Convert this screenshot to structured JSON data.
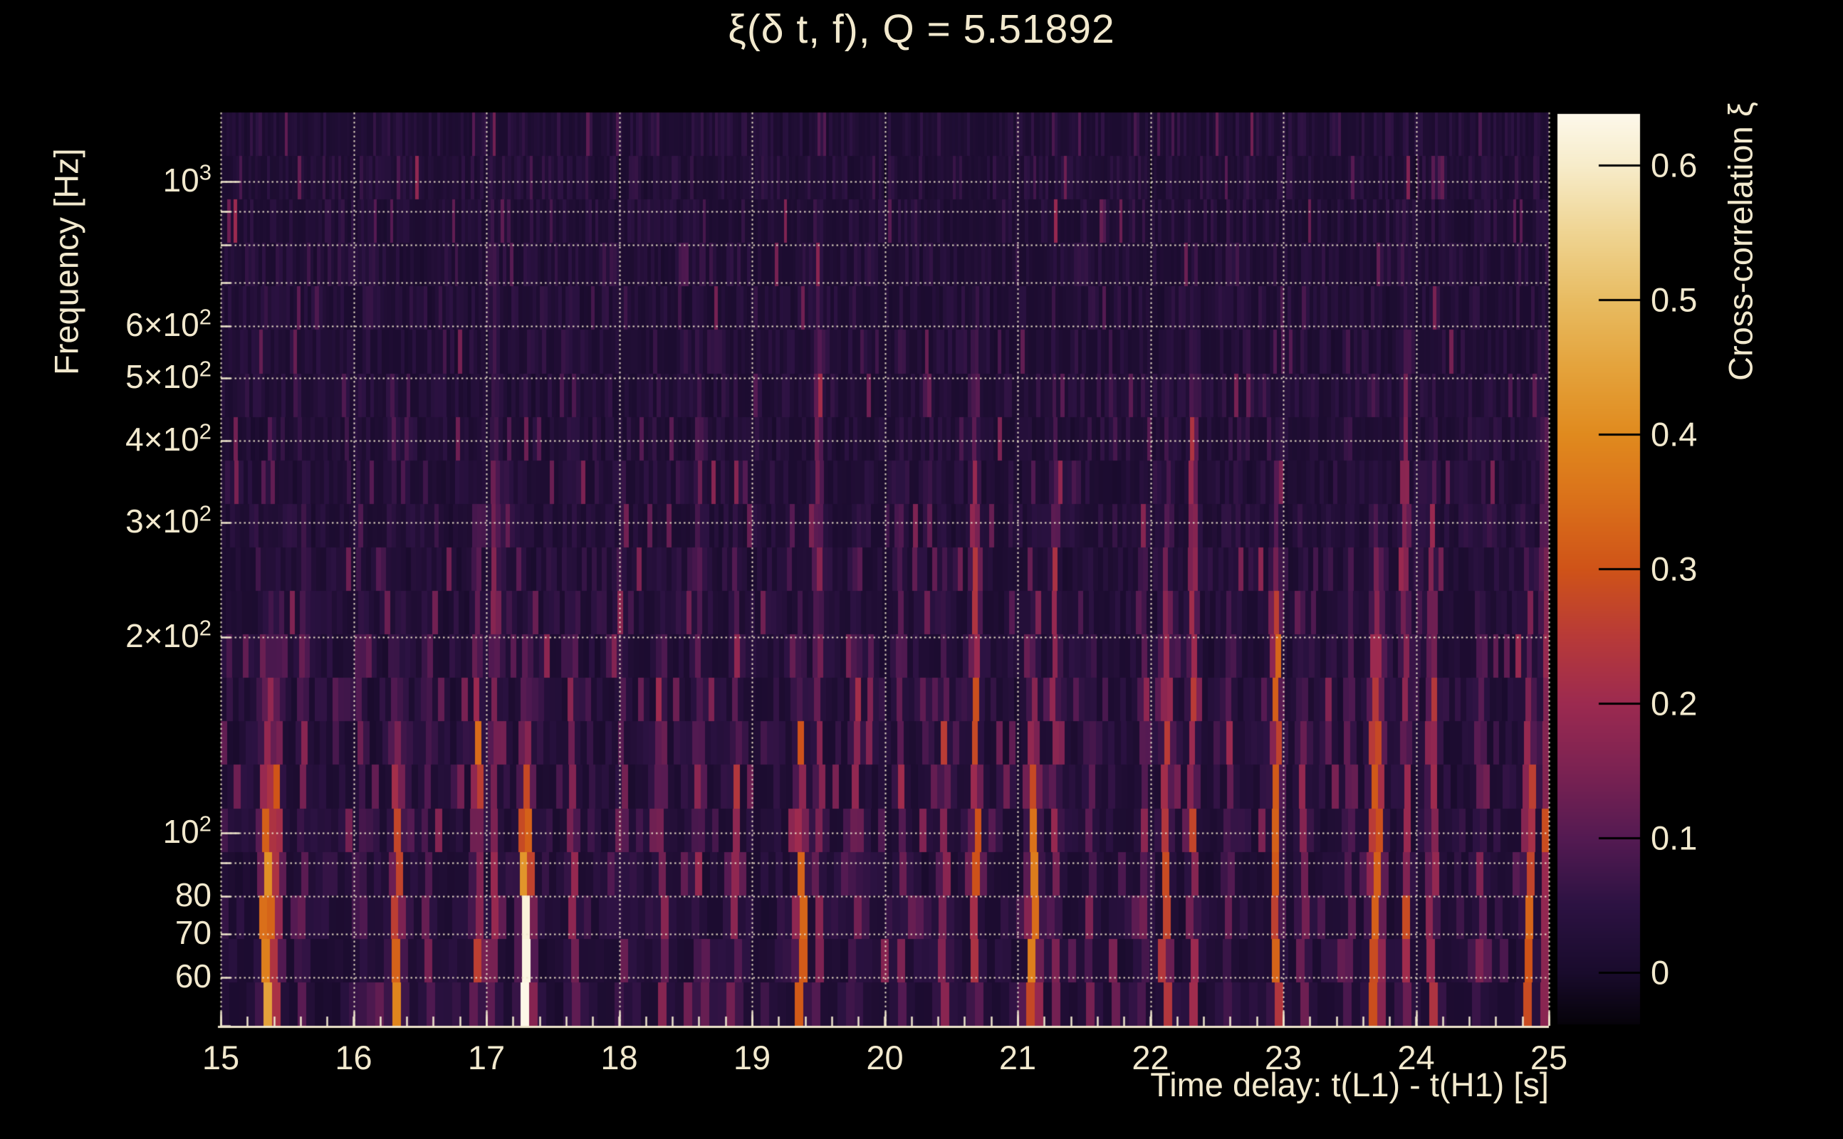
{
  "background": "#000000",
  "text_color": "#f2e9ce",
  "grid_color": "#efe6cc",
  "chart_data": {
    "type": "heatmap",
    "title": "ξ(δ t, f), Q = 5.51892",
    "q_value": "5.51892",
    "xlabel": "Time delay: t(L1) - t(H1) [s]",
    "ylabel": "Frequency [Hz]",
    "colorbar_label": "Cross-correlation ξ",
    "x_range": [
      15,
      25
    ],
    "x_ticks": [
      15,
      16,
      17,
      18,
      19,
      20,
      21,
      22,
      23,
      24,
      25
    ],
    "x_minor_step": 0.2,
    "y_scale": "log",
    "y_range_hz": [
      50.6,
      1277
    ],
    "y_ticks": [
      {
        "f": 1000,
        "m": "10",
        "e": "3"
      },
      {
        "f": 600,
        "m": "6×10",
        "e": "2"
      },
      {
        "f": 500,
        "m": "5×10",
        "e": "2"
      },
      {
        "f": 400,
        "m": "4×10",
        "e": "2"
      },
      {
        "f": 300,
        "m": "3×10",
        "e": "2"
      },
      {
        "f": 200,
        "m": "2×10",
        "e": "2"
      },
      {
        "f": 100,
        "m": "10",
        "e": "2"
      },
      {
        "f": 80,
        "m": "80"
      },
      {
        "f": 70,
        "m": "70"
      },
      {
        "f": 60,
        "m": "60"
      }
    ],
    "y_gridlines_hz": [
      60,
      70,
      80,
      90,
      100,
      200,
      300,
      400,
      500,
      600,
      700,
      800,
      900,
      1000
    ],
    "grid": "dotted",
    "color_range": [
      -0.038,
      0.638
    ],
    "colorbar_ticks": [
      {
        "v": 0.6,
        "label": "0.6"
      },
      {
        "v": 0.5,
        "label": "0.5"
      },
      {
        "v": 0.4,
        "label": "0.4"
      },
      {
        "v": 0.3,
        "label": "0.3"
      },
      {
        "v": 0.2,
        "label": "0.2"
      },
      {
        "v": 0.1,
        "label": "0.1"
      },
      {
        "v": 0.0,
        "label": "0"
      }
    ],
    "colormap": {
      "name": "inferno-like",
      "stops": [
        [
          -0.04,
          "#050208"
        ],
        [
          0.0,
          "#190b2c"
        ],
        [
          0.05,
          "#2c1242"
        ],
        [
          0.1,
          "#541a52"
        ],
        [
          0.15,
          "#7b2252"
        ],
        [
          0.2,
          "#9c2a50"
        ],
        [
          0.25,
          "#b83a38"
        ],
        [
          0.3,
          "#cf5318"
        ],
        [
          0.35,
          "#da701a"
        ],
        [
          0.4,
          "#e08a1e"
        ],
        [
          0.45,
          "#e4a33c"
        ],
        [
          0.5,
          "#e8bc62"
        ],
        [
          0.55,
          "#efd492"
        ],
        [
          0.6,
          "#f7ecca"
        ],
        [
          0.638,
          "#fdf8ea"
        ]
      ]
    },
    "rows": 21,
    "noise": {
      "seed": 20250419,
      "base": 0.008,
      "spread": 0.055,
      "midband_center_logf": 2.15,
      "midband_sigma": 0.3
    },
    "streaks": [
      {
        "t": 15.35,
        "xi": 0.4,
        "fmax_hz": 75,
        "w": 0.03
      },
      {
        "t": 15.43,
        "xi": 0.18,
        "fmax_hz": 95,
        "w": 0.025
      },
      {
        "t": 15.62,
        "xi": 0.1,
        "fmax_hz": 150,
        "w": 0.02
      },
      {
        "t": 16.05,
        "xi": 0.08,
        "fmax_hz": 120,
        "w": 0.02
      },
      {
        "t": 16.33,
        "xi": 0.34,
        "fmax_hz": 70,
        "w": 0.028
      },
      {
        "t": 16.55,
        "xi": 0.1,
        "fmax_hz": 110,
        "w": 0.02
      },
      {
        "t": 16.93,
        "xi": 0.22,
        "fmax_hz": 120,
        "w": 0.022
      },
      {
        "t": 17.06,
        "xi": 0.14,
        "fmax_hz": 250,
        "w": 0.02
      },
      {
        "t": 17.3,
        "xi": 0.62,
        "fmax_hz": 62,
        "w": 0.03
      },
      {
        "t": 17.65,
        "xi": 0.16,
        "fmax_hz": 100,
        "w": 0.022
      },
      {
        "t": 18.02,
        "xi": 0.1,
        "fmax_hz": 140,
        "w": 0.02
      },
      {
        "t": 18.32,
        "xi": 0.13,
        "fmax_hz": 110,
        "w": 0.02
      },
      {
        "t": 18.6,
        "xi": 0.09,
        "fmax_hz": 300,
        "w": 0.02
      },
      {
        "t": 18.88,
        "xi": 0.12,
        "fmax_hz": 130,
        "w": 0.02
      },
      {
        "t": 19.37,
        "xi": 0.36,
        "fmax_hz": 68,
        "w": 0.026
      },
      {
        "t": 19.5,
        "xi": 0.12,
        "fmax_hz": 400,
        "w": 0.02
      },
      {
        "t": 19.78,
        "xi": 0.14,
        "fmax_hz": 120,
        "w": 0.02
      },
      {
        "t": 20.12,
        "xi": 0.1,
        "fmax_hz": 200,
        "w": 0.02
      },
      {
        "t": 20.45,
        "xi": 0.16,
        "fmax_hz": 110,
        "w": 0.022
      },
      {
        "t": 20.68,
        "xi": 0.22,
        "fmax_hz": 220,
        "w": 0.022
      },
      {
        "t": 21.12,
        "xi": 0.38,
        "fmax_hz": 80,
        "w": 0.028
      },
      {
        "t": 21.28,
        "xi": 0.14,
        "fmax_hz": 200,
        "w": 0.02
      },
      {
        "t": 21.55,
        "xi": 0.1,
        "fmax_hz": 100,
        "w": 0.02
      },
      {
        "t": 21.95,
        "xi": 0.09,
        "fmax_hz": 150,
        "w": 0.02
      },
      {
        "t": 22.12,
        "xi": 0.24,
        "fmax_hz": 130,
        "w": 0.022
      },
      {
        "t": 22.32,
        "xi": 0.2,
        "fmax_hz": 250,
        "w": 0.022
      },
      {
        "t": 22.6,
        "xi": 0.1,
        "fmax_hz": 120,
        "w": 0.02
      },
      {
        "t": 22.95,
        "xi": 0.3,
        "fmax_hz": 140,
        "w": 0.024
      },
      {
        "t": 23.15,
        "xi": 0.14,
        "fmax_hz": 100,
        "w": 0.02
      },
      {
        "t": 23.5,
        "xi": 0.1,
        "fmax_hz": 150,
        "w": 0.02
      },
      {
        "t": 23.7,
        "xi": 0.32,
        "fmax_hz": 110,
        "w": 0.034
      },
      {
        "t": 23.92,
        "xi": 0.16,
        "fmax_hz": 300,
        "w": 0.02
      },
      {
        "t": 24.12,
        "xi": 0.2,
        "fmax_hz": 160,
        "w": 0.022
      },
      {
        "t": 24.48,
        "xi": 0.1,
        "fmax_hz": 130,
        "w": 0.02
      },
      {
        "t": 24.85,
        "xi": 0.3,
        "fmax_hz": 90,
        "w": 0.024
      },
      {
        "t": 24.97,
        "xi": 0.16,
        "fmax_hz": 200,
        "w": 0.02
      }
    ]
  }
}
